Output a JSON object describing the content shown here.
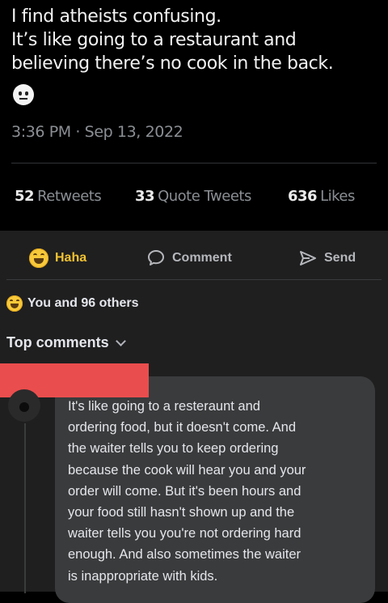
{
  "tweet": {
    "text_lines": [
      "I find atheists confusing.",
      "It’s like going to a restaurant and",
      "believing there’s no cook in the back."
    ],
    "emoji": "neutral-face-icon",
    "timestamp": "3:36 PM · Sep 13, 2022",
    "stats": {
      "retweets_count": "52",
      "retweets_label": "Retweets",
      "quote_count": "33",
      "quote_label": "Quote Tweets",
      "likes_count": "636",
      "likes_label": "Likes"
    }
  },
  "facebook": {
    "actions": {
      "haha_label": "Haha",
      "comment_label": "Comment",
      "send_label": "Send"
    },
    "reactions_text": "You and 96 others",
    "top_comments_label": "Top comments",
    "comment": {
      "lines": [
        "It's like going to a resteraunt and",
        "ordering food, but it doesn't come. And",
        "the waiter tells you to keep ordering",
        "because the cook will hear you and your",
        "order will come. But it's been hours and",
        "your food still hasn't shown up and the",
        "waiter tells you you're not ordering hard",
        "enough. And also sometimes the waiter",
        "is inappropriate with kids."
      ]
    },
    "colors": {
      "redaction": "#ea4d4d",
      "haha": "#f1c232"
    }
  }
}
